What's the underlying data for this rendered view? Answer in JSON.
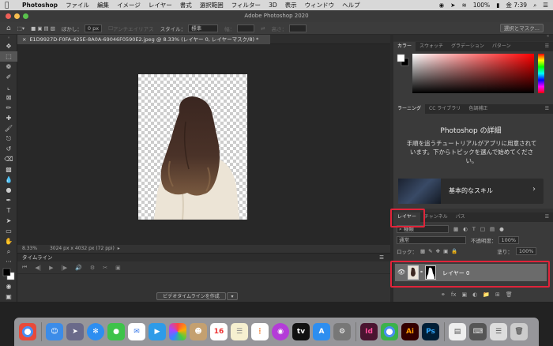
{
  "menubar": {
    "apple": "",
    "app": "Photoshop",
    "items": [
      "ファイル",
      "編集",
      "イメージ",
      "レイヤー",
      "書式",
      "選択範囲",
      "フィルター",
      "3D",
      "表示",
      "ウィンドウ",
      "ヘルプ"
    ],
    "battery": "100%",
    "time": "金 7:39"
  },
  "window": {
    "title": "Adobe Photoshop 2020"
  },
  "options": {
    "blur_label": "ぼかし：",
    "blur_value": "0 px",
    "antialias": "アンチエイリアス",
    "style_label": "スタイル：",
    "style_value": "標準",
    "width_label": "幅：",
    "height_label": "高さ：",
    "select_mask_button": "選択とマスク..."
  },
  "document": {
    "tab_title": "E1D9927D-F0FA-425E-8A0A-69046F0590E2.jpeg @ 8.33% (レイヤー 0, レイヤーマスク/8) *",
    "zoom": "8.33%",
    "size_info": "3024 px x 4032 px (72 ppi)"
  },
  "timeline": {
    "title": "タイムライン",
    "create_button": "ビデオタイムラインを作成"
  },
  "color_panel": {
    "tabs": [
      "カラー",
      "スウォッチ",
      "グラデーション",
      "パターン"
    ]
  },
  "learn_panel": {
    "tabs": [
      "ラーニング",
      "CC ライブラリ",
      "色調補正"
    ],
    "heading": "Photoshop の詳細",
    "body": "手順を追うチュートリアルがアプリに用意されています。下からトピックを選んで始めてください。",
    "card_label": "基本的なスキル"
  },
  "layers_panel": {
    "tabs": [
      "レイヤー",
      "チャンネル",
      "パス"
    ],
    "filter_kind": "種類",
    "blend_mode": "通常",
    "opacity_label": "不透明度：",
    "opacity_value": "100%",
    "lock_label": "ロック：",
    "fill_label": "塗り：",
    "fill_value": "100%",
    "layer_name": "レイヤー 0"
  },
  "colors": {
    "highlight": "#e0243a"
  }
}
